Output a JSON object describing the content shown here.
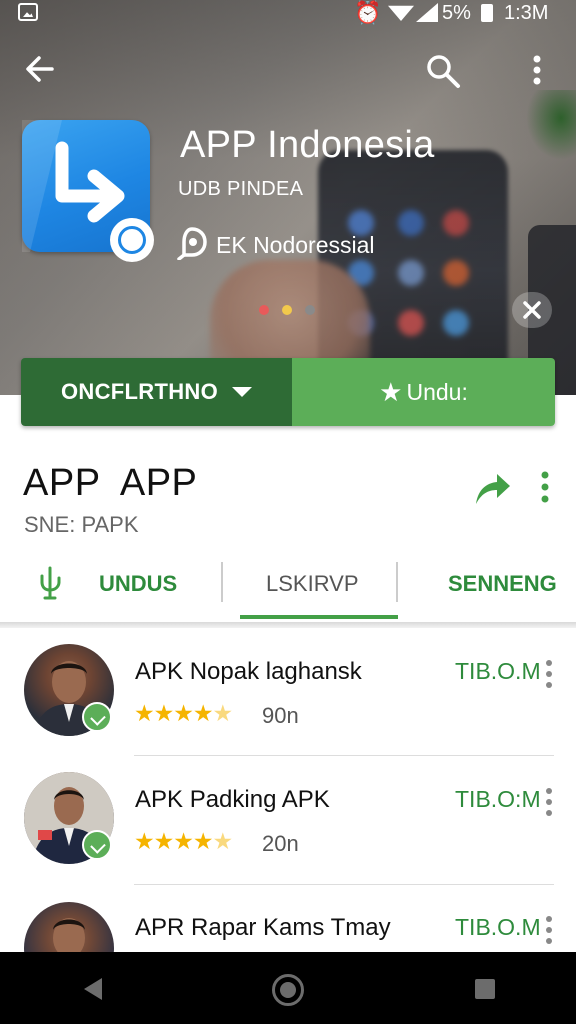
{
  "status_bar": {
    "battery_pct": "5%",
    "time": "1:3M"
  },
  "app": {
    "title": "APP Indonesia",
    "developer": "UDB PINDEA",
    "meta": "EK Nodoressial"
  },
  "actions": {
    "primary_label": "ONCFLRTHNO",
    "secondary_label": "Undu:"
  },
  "content": {
    "title": "APP  APP",
    "subtitle": "SNE: PAPK"
  },
  "tabs": [
    {
      "label": "UNDUS"
    },
    {
      "label": "LSKIRVP"
    },
    {
      "label": "SENNENG"
    }
  ],
  "list": [
    {
      "name": "APK Nopak laghansk",
      "rating": 4.5,
      "count": "90n",
      "price": "TIB.O.M"
    },
    {
      "name": "APK Padking APK",
      "rating": 4.5,
      "count": "20n",
      "price": "TIB.O:M"
    },
    {
      "name": "APR Rapar Kams Tmay",
      "price": "TIB.O.M"
    }
  ],
  "colors": {
    "accent_green": "#5cae58",
    "dark_green": "#2e6b35",
    "app_icon_blue": "#1e86e3",
    "star_yellow": "#f5b400"
  }
}
